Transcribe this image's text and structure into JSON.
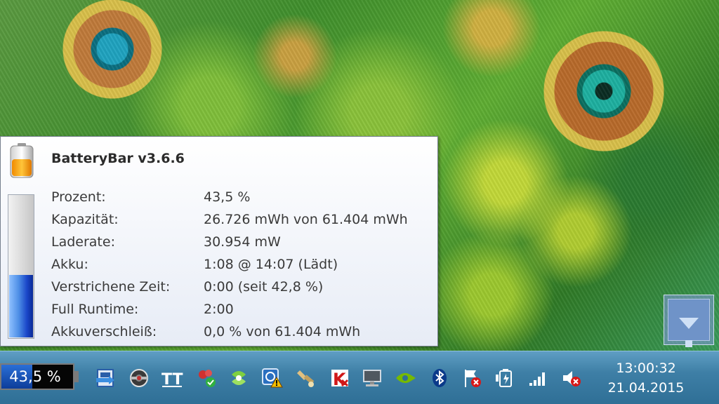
{
  "tooltip": {
    "title": "BatteryBar v3.6.6",
    "rows": [
      {
        "label": "Prozent:",
        "value": "43,5 %"
      },
      {
        "label": "Kapazität:",
        "value": "26.726 mWh von 61.404 mWh"
      },
      {
        "label": "Laderate:",
        "value": "30.954 mW"
      },
      {
        "label": "Akku:",
        "value": "1:08 @ 14:07 (Lädt)"
      },
      {
        "label": "Verstrichene Zeit:",
        "value": "0:00 (seit 42,8 %)"
      },
      {
        "label": "Full Runtime:",
        "value": "2:00"
      },
      {
        "label": "Akkuverschleiß:",
        "value": "0,0 % von 61.404 mWh"
      }
    ],
    "charge_fraction": 0.435
  },
  "taskbar": {
    "battery_bar_text": "43,5 %",
    "tray_icons": [
      "network-drive-icon",
      "steering-wheel-icon",
      "font-tool-icon",
      "flower-app-icon",
      "sync-app-icon",
      "network-warning-icon",
      "torch-icon",
      "kaspersky-icon",
      "monitor-icon",
      "nvidia-icon",
      "bluetooth-icon",
      "action-center-flag-icon",
      "battery-charging-icon",
      "signal-strength-icon",
      "volume-muted-icon"
    ],
    "clock_time": "13:00:32",
    "clock_date": "21.04.2015"
  },
  "colors": {
    "tooltip_bg": "#eef1f8",
    "charge_blue": "#1a46c8",
    "taskbar": "#3e7fa6"
  }
}
